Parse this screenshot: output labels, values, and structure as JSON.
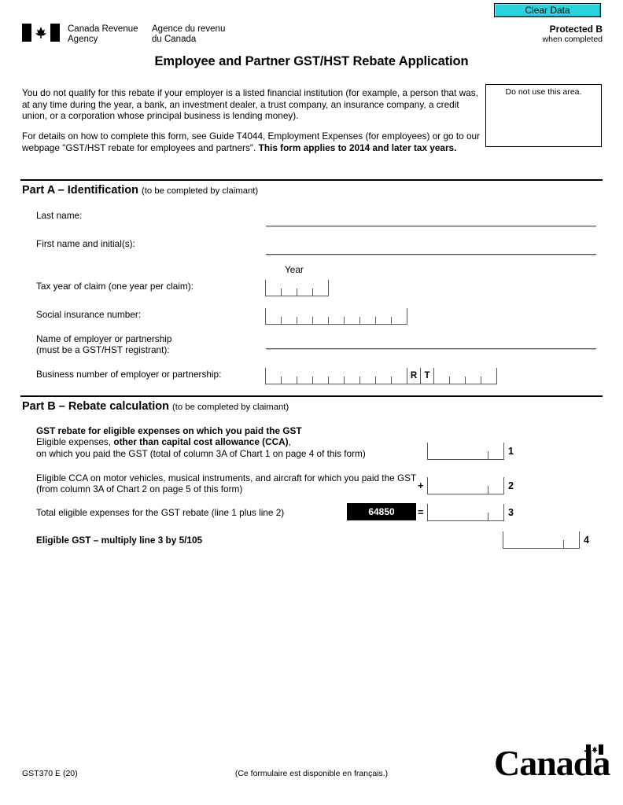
{
  "toolbar": {
    "clear_data_label": "Clear Data",
    "clear_data_color": "#2ad4de"
  },
  "header": {
    "agency_en": "Canada Revenue\nAgency",
    "agency_fr": "Agence du revenu\ndu Canada",
    "protected_label": "Protected B",
    "protected_sub": "when completed",
    "flag_icon": "canada-flag-icon"
  },
  "title": "Employee and Partner GST/HST Rebate Application",
  "intro": {
    "paragraph_1_part_1": "You do not qualify for this rebate if your employer is a listed financial institution (for example, a person that was, at any time during the year, a bank, an investment dealer, a trust company, an insurance company, a credit union, or a corporation whose principal business is lending money).",
    "paragraph_2_part_1": "For details on how to complete this form, see Guide T4044, Employment Expenses (for employees) or go to our webpage \"GST/HST rebate for employees and partners\". ",
    "paragraph_2_bold": "This form applies to 2014 and later tax years."
  },
  "do_not_use_area": {
    "label": "Do not use this area."
  },
  "part_a": {
    "heading": "Part A – Identification",
    "heading_sub": "(to be completed by claimant)",
    "labels": {
      "last_name": "Last name:",
      "first_name": "First name and initial(s):",
      "tax_year": "Tax year of claim (one year per claim):",
      "sin": "Social insurance number:",
      "employer_name": "Name of employer or partnership\n(must be a GST/HST registrant):",
      "business_number": "Business number of employer or partnership:"
    },
    "year_caption": "Year",
    "values": {
      "last_name": "",
      "first_name": "",
      "employer_name": ""
    },
    "comb_cells": {
      "tax_year": 4,
      "sin": 9,
      "business_number_prefix": 9,
      "business_number_suffix": 4
    },
    "business_number_letters": [
      "R",
      "T"
    ]
  },
  "part_b": {
    "heading": "Part B – Rebate calculation",
    "heading_sub": "(to be completed by claimant)",
    "line1": {
      "bold_heading": "GST rebate for eligible expenses on which you paid the GST",
      "text_a": "Eligible expenses, ",
      "text_bold": "other than capital cost allowance (CCA)",
      "text_b": ",",
      "text_c": "on which you paid the GST (total of column 3A of Chart 1 on page 4 of this form)",
      "number": "1",
      "value": ""
    },
    "line2": {
      "text": "Eligible CCA on motor vehicles, musical instruments, and aircraft for which you paid the GST (from column 3A of Chart 2 on page 5 of this form)",
      "operator": "+",
      "number": "2",
      "value": ""
    },
    "line3": {
      "text": "Total eligible expenses for the GST rebate (line 1 plus line 2)",
      "field_code": "64850",
      "operator": "=",
      "number": "3",
      "value": ""
    },
    "line4": {
      "text": "Eligible GST – multiply line 3 by 5/105",
      "number": "4",
      "value": ""
    }
  },
  "footer": {
    "form_code": "GST370 E (20)",
    "french_note": "(Ce formulaire est disponible en français.)",
    "wordmark": "Canada",
    "wordmark_flag_icon": "canada-flag-icon"
  }
}
